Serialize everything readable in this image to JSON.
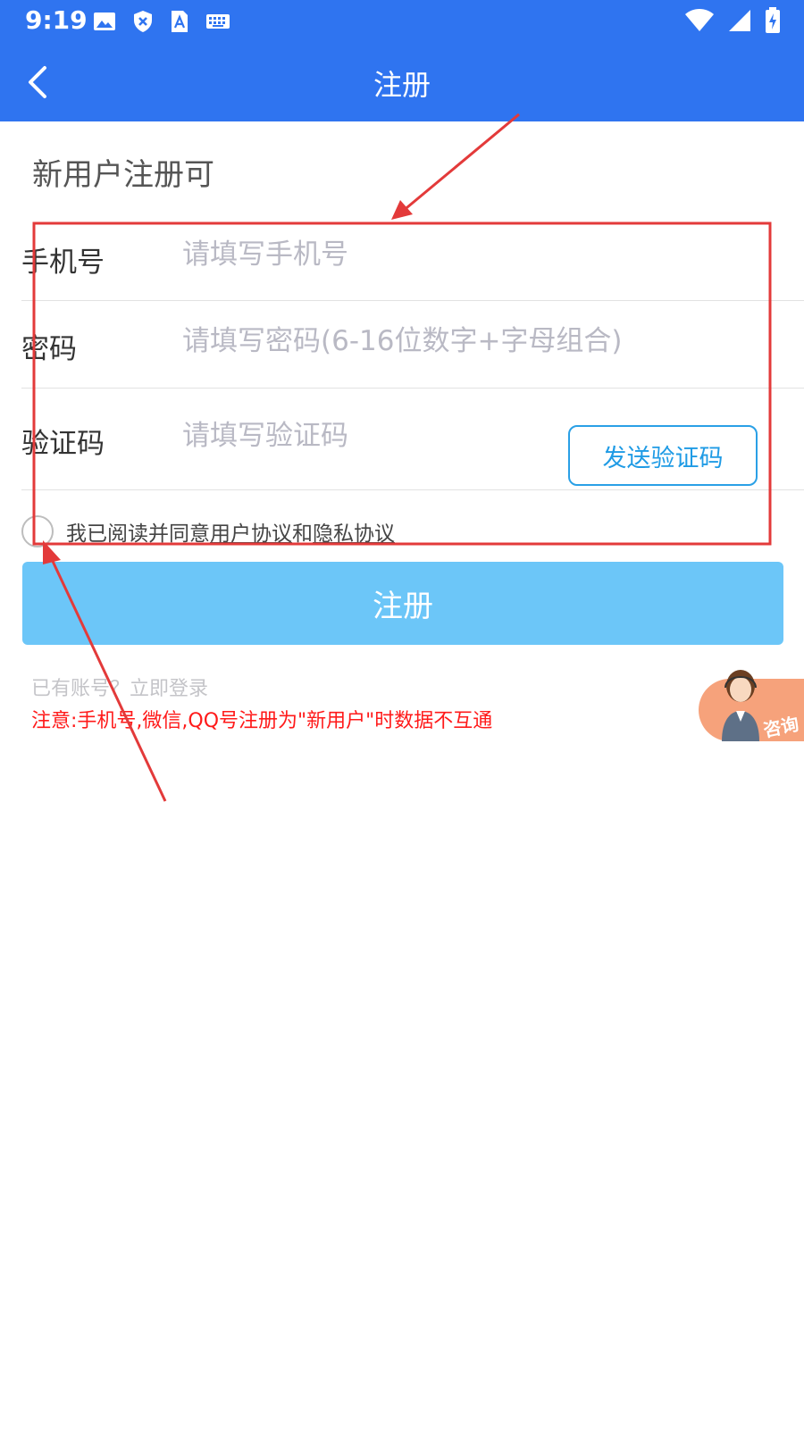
{
  "status_bar": {
    "time": "9:19",
    "left_icons": [
      "image-icon",
      "shield-icon",
      "font-icon",
      "keyboard-icon"
    ],
    "right_icons": [
      "wifi-icon",
      "signal-icon",
      "battery-charging-icon"
    ]
  },
  "header": {
    "title": "注册"
  },
  "intro": "新用户注册可",
  "form": {
    "phone": {
      "label": "手机号",
      "placeholder": "请填写手机号"
    },
    "password": {
      "label": "密码",
      "placeholder": "请填写密码(6-16位数字+字母组合)"
    },
    "code": {
      "label": "验证码",
      "placeholder": "请填写验证码",
      "send_button": "发送验证码"
    }
  },
  "agreement": {
    "prefix": "我已阅读并同意",
    "user_agreement": "用户协议",
    "conjunction": "和",
    "privacy_agreement": "隐私协议",
    "checked": false
  },
  "register_button": "注册",
  "login_prompt": "已有账号？立即登录",
  "notice": "注意:手机号,微信,QQ号注册为\"新用户\"时数据不互通",
  "consult_widget": {
    "label": "咨询"
  },
  "colors": {
    "header": "#2f74f0",
    "register_button": "#6cc6f8",
    "send_button_border": "#2aa0e6",
    "notice": "#ff1a1a",
    "annotation": "#e33a3a"
  }
}
